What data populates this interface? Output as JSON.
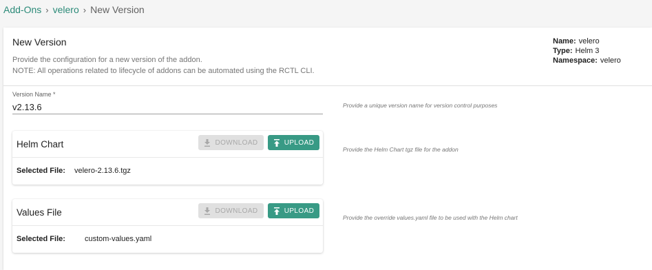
{
  "breadcrumb": {
    "addons": "Add-Ons",
    "addon": "velero",
    "current": "New Version",
    "sep": "›"
  },
  "header": {
    "title": "New Version",
    "desc1": "Provide the configuration for a new version of the addon.",
    "desc2": "NOTE: All operations related to lifecycle of addons can be automated using the RCTL CLI."
  },
  "meta": {
    "name_label": "Name:",
    "name_value": "velero",
    "type_label": "Type:",
    "type_value": "Helm 3",
    "ns_label": "Namespace:",
    "ns_value": "velero"
  },
  "version": {
    "label": "Version Name *",
    "value": "v2.13.6",
    "hint": "Provide a unique version name for version control purposes"
  },
  "helm_chart": {
    "title": "Helm Chart",
    "download": "DOWNLOAD",
    "upload": "UPLOAD",
    "selected_label": "Selected File:",
    "selected_value": "velero-2.13.6.tgz",
    "hint": "Provide the Helm Chart tgz file for the addon"
  },
  "values_file": {
    "title": "Values File",
    "download": "DOWNLOAD",
    "upload": "UPLOAD",
    "selected_label": "Selected File:",
    "selected_value": "custom-values.yaml",
    "hint": "Provide the override values.yaml file to be used with the Helm chart"
  },
  "colors": {
    "accent": "#389a85",
    "link": "#2b8a78"
  }
}
